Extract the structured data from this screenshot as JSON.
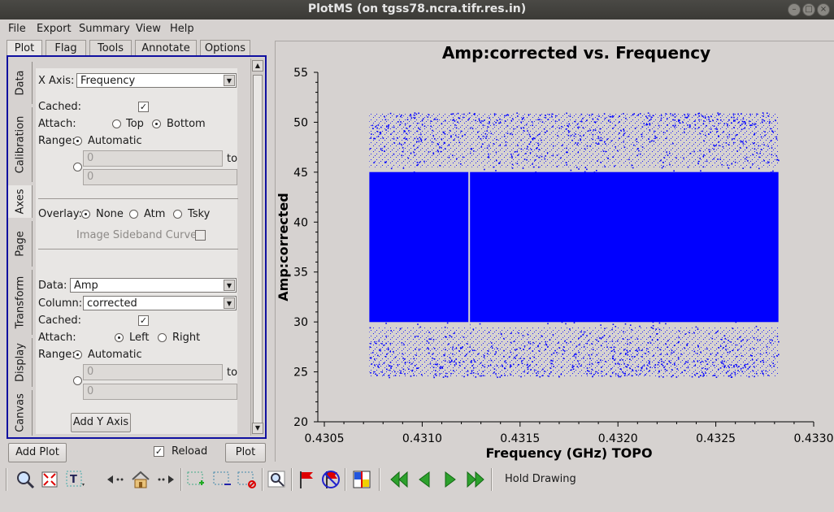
{
  "window": {
    "title": "PlotMS (on tgss78.ncra.tifr.res.in)"
  },
  "menu": [
    "File",
    "Export",
    "Summary",
    "View",
    "Help"
  ],
  "tabs": [
    "Plot",
    "Flag",
    "Tools",
    "Annotate",
    "Options"
  ],
  "vtabs": [
    "Data",
    "Calibration",
    "Axes",
    "Page",
    "Transform",
    "Display",
    "Canvas"
  ],
  "xaxis": {
    "label": "X Axis:",
    "value": "Frequency",
    "cached_label": "Cached:",
    "cached": true,
    "attach_label": "Attach:",
    "attach_top": "Top",
    "attach_bottom": "Bottom",
    "range_label": "Range:",
    "range_auto": "Automatic",
    "range_min": "0",
    "range_max": "0",
    "to": "to"
  },
  "overlay": {
    "label": "Overlay:",
    "none": "None",
    "atm": "Atm",
    "tsky": "Tsky",
    "sideband": "Image Sideband Curve:"
  },
  "yaxis": {
    "data_label": "Data:",
    "data_value": "Amp",
    "column_label": "Column:",
    "column_value": "corrected",
    "cached_label": "Cached:",
    "cached": true,
    "attach_label": "Attach:",
    "attach_left": "Left",
    "attach_right": "Right",
    "range_label": "Range:",
    "range_auto": "Automatic",
    "range_min": "0",
    "range_max": "0",
    "to": "to",
    "add_button": "Add Y Axis"
  },
  "bottom": {
    "add_plot": "Add Plot",
    "reload": "Reload",
    "reload_checked": true,
    "plot": "Plot"
  },
  "toolbar": {
    "hold_drawing": "Hold Drawing"
  },
  "chart_data": {
    "type": "scatter",
    "title": "Amp:corrected vs. Frequency",
    "xlabel": "Frequency (GHz) TOPO",
    "ylabel": "Amp:corrected",
    "xlim": [
      0.4305,
      0.433
    ],
    "ylim": [
      20,
      55
    ],
    "xticks": [
      "0.4305",
      "0.4310",
      "0.4315",
      "0.4320",
      "0.4325",
      "0.4330"
    ],
    "yticks": [
      "20",
      "25",
      "30",
      "35",
      "40",
      "45",
      "50",
      "55"
    ],
    "point_color": "#0000ff",
    "dense_band": {
      "x": [
        0.43073,
        0.43282
      ],
      "y": [
        29.5,
        45.5
      ]
    },
    "sparse_extent": {
      "y": [
        24.5,
        51
      ]
    },
    "gap_x": 0.43124,
    "grid": false
  }
}
